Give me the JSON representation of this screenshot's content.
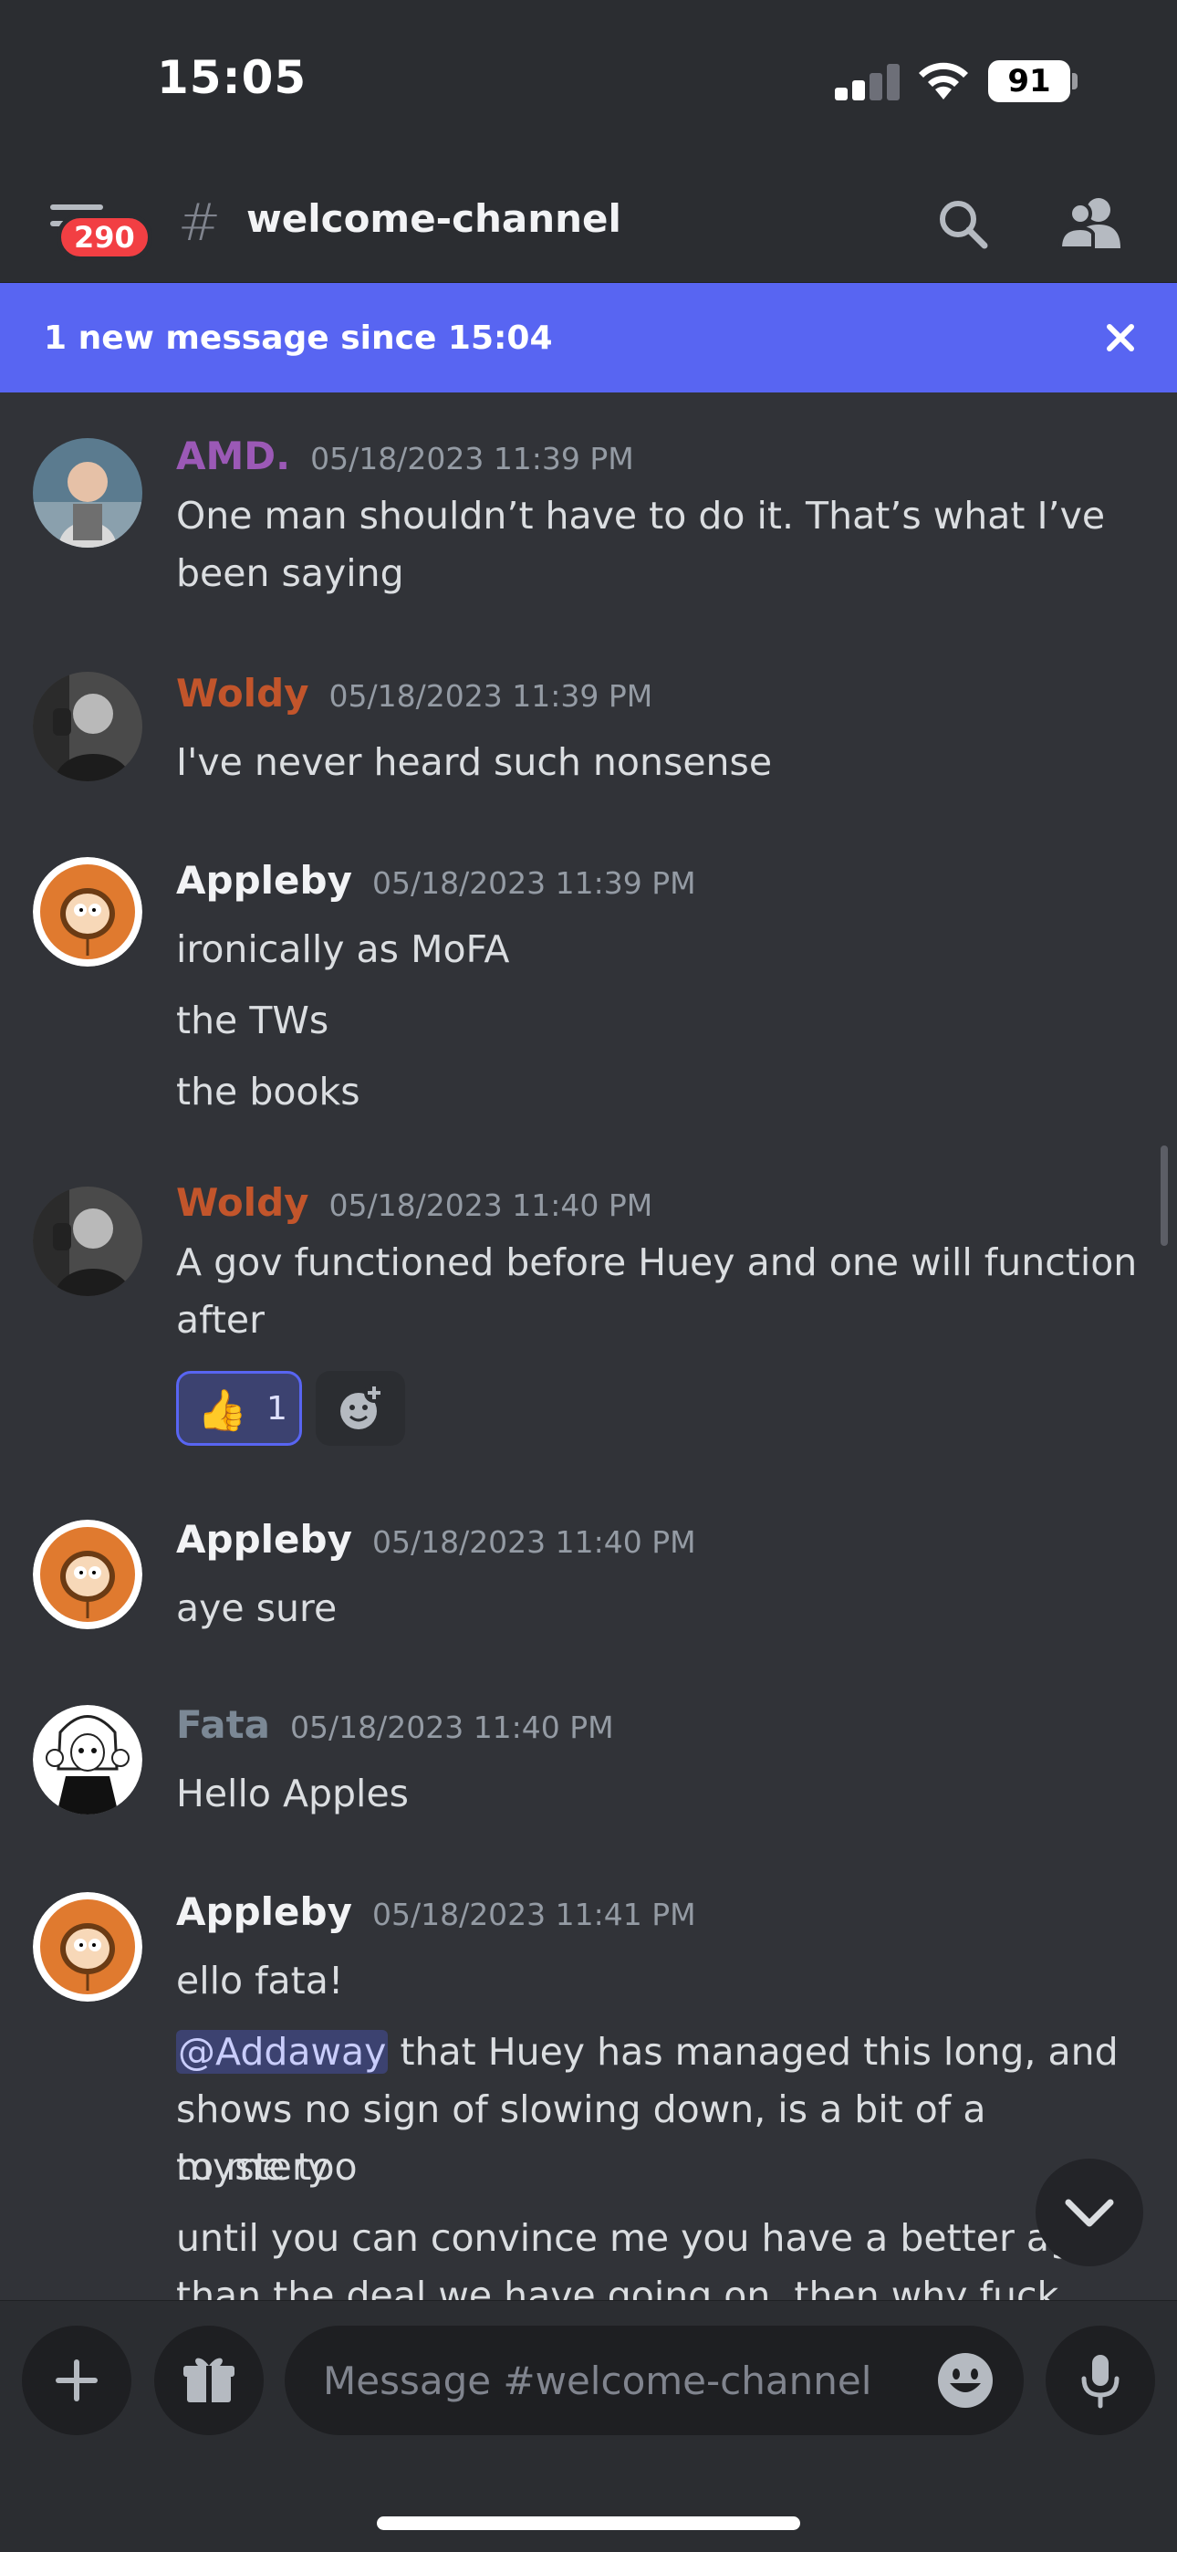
{
  "status_bar": {
    "time": "15:05",
    "battery": "91"
  },
  "header": {
    "channel_name": "welcome-channel",
    "unread_badge": "290"
  },
  "banner": {
    "text": "1 new message since 15:04"
  },
  "messages": [
    {
      "author": "AMD.",
      "author_color": "#9b59b6",
      "timestamp": "05/18/2023 11:39 PM",
      "lines": [
        "One man shouldn’t have to do it. That’s what I’ve",
        "been saying"
      ]
    },
    {
      "author": "Woldy",
      "author_color": "#c2552b",
      "timestamp": "05/18/2023 11:39 PM",
      "lines": [
        "I've never heard such nonsense"
      ]
    },
    {
      "author": "Appleby",
      "author_color": "#f2f3f5",
      "timestamp": "05/18/2023 11:39 PM",
      "lines": [
        "ironically as MoFA",
        "the TWs",
        "the books"
      ]
    },
    {
      "author": "Woldy",
      "author_color": "#c2552b",
      "timestamp": "05/18/2023 11:40 PM",
      "lines": [
        "A gov functioned before Huey and one will function",
        "after"
      ],
      "reaction": {
        "emoji": "👍",
        "count": "1"
      }
    },
    {
      "author": "Appleby",
      "author_color": "#f2f3f5",
      "timestamp": "05/18/2023 11:40 PM",
      "lines": [
        "aye sure"
      ]
    },
    {
      "author": "Fata",
      "author_color": "#7b8895",
      "timestamp": "05/18/2023 11:40 PM",
      "lines": [
        "Hello Apples"
      ]
    },
    {
      "author": "Appleby",
      "author_color": "#f2f3f5",
      "timestamp": "05/18/2023 11:41 PM",
      "lines": [
        "ello fata!"
      ],
      "mention": "@Addaway",
      "mention_line_rest": " that Huey has managed this long, and",
      "more_lines": [
        "shows no sign of slowing down, is a bit of a mystery",
        "to me too",
        "until you can convince me you have a better age",
        "than the deal we have going on, then why fuck"
      ]
    }
  ],
  "composer": {
    "placeholder": "Message #welcome-channel"
  },
  "icons": {
    "menu": "hamburger-menu-icon",
    "hash": "hash-icon",
    "search": "search-icon",
    "members": "members-icon",
    "close": "close-icon",
    "add": "plus-icon",
    "gift": "gift-icon",
    "emoji": "emoji-icon",
    "mic": "microphone-icon",
    "jump": "chevron-down-icon",
    "add_reaction": "add-reaction-icon"
  }
}
